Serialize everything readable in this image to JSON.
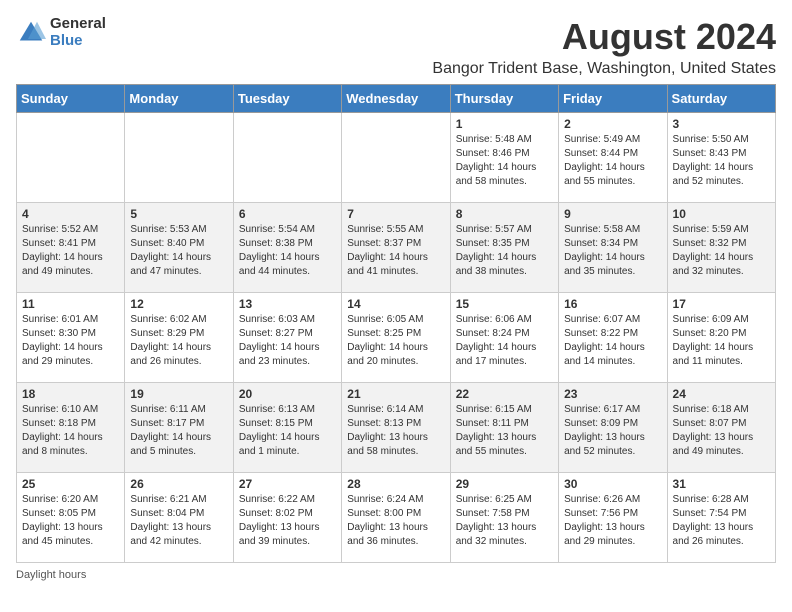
{
  "logo": {
    "general": "General",
    "blue": "Blue"
  },
  "title": "August 2024",
  "subtitle": "Bangor Trident Base, Washington, United States",
  "days_of_week": [
    "Sunday",
    "Monday",
    "Tuesday",
    "Wednesday",
    "Thursday",
    "Friday",
    "Saturday"
  ],
  "footer": "Daylight hours",
  "weeks": [
    [
      {
        "day": "",
        "info": ""
      },
      {
        "day": "",
        "info": ""
      },
      {
        "day": "",
        "info": ""
      },
      {
        "day": "",
        "info": ""
      },
      {
        "day": "1",
        "info": "Sunrise: 5:48 AM\nSunset: 8:46 PM\nDaylight: 14 hours\nand 58 minutes."
      },
      {
        "day": "2",
        "info": "Sunrise: 5:49 AM\nSunset: 8:44 PM\nDaylight: 14 hours\nand 55 minutes."
      },
      {
        "day": "3",
        "info": "Sunrise: 5:50 AM\nSunset: 8:43 PM\nDaylight: 14 hours\nand 52 minutes."
      }
    ],
    [
      {
        "day": "4",
        "info": "Sunrise: 5:52 AM\nSunset: 8:41 PM\nDaylight: 14 hours\nand 49 minutes."
      },
      {
        "day": "5",
        "info": "Sunrise: 5:53 AM\nSunset: 8:40 PM\nDaylight: 14 hours\nand 47 minutes."
      },
      {
        "day": "6",
        "info": "Sunrise: 5:54 AM\nSunset: 8:38 PM\nDaylight: 14 hours\nand 44 minutes."
      },
      {
        "day": "7",
        "info": "Sunrise: 5:55 AM\nSunset: 8:37 PM\nDaylight: 14 hours\nand 41 minutes."
      },
      {
        "day": "8",
        "info": "Sunrise: 5:57 AM\nSunset: 8:35 PM\nDaylight: 14 hours\nand 38 minutes."
      },
      {
        "day": "9",
        "info": "Sunrise: 5:58 AM\nSunset: 8:34 PM\nDaylight: 14 hours\nand 35 minutes."
      },
      {
        "day": "10",
        "info": "Sunrise: 5:59 AM\nSunset: 8:32 PM\nDaylight: 14 hours\nand 32 minutes."
      }
    ],
    [
      {
        "day": "11",
        "info": "Sunrise: 6:01 AM\nSunset: 8:30 PM\nDaylight: 14 hours\nand 29 minutes."
      },
      {
        "day": "12",
        "info": "Sunrise: 6:02 AM\nSunset: 8:29 PM\nDaylight: 14 hours\nand 26 minutes."
      },
      {
        "day": "13",
        "info": "Sunrise: 6:03 AM\nSunset: 8:27 PM\nDaylight: 14 hours\nand 23 minutes."
      },
      {
        "day": "14",
        "info": "Sunrise: 6:05 AM\nSunset: 8:25 PM\nDaylight: 14 hours\nand 20 minutes."
      },
      {
        "day": "15",
        "info": "Sunrise: 6:06 AM\nSunset: 8:24 PM\nDaylight: 14 hours\nand 17 minutes."
      },
      {
        "day": "16",
        "info": "Sunrise: 6:07 AM\nSunset: 8:22 PM\nDaylight: 14 hours\nand 14 minutes."
      },
      {
        "day": "17",
        "info": "Sunrise: 6:09 AM\nSunset: 8:20 PM\nDaylight: 14 hours\nand 11 minutes."
      }
    ],
    [
      {
        "day": "18",
        "info": "Sunrise: 6:10 AM\nSunset: 8:18 PM\nDaylight: 14 hours\nand 8 minutes."
      },
      {
        "day": "19",
        "info": "Sunrise: 6:11 AM\nSunset: 8:17 PM\nDaylight: 14 hours\nand 5 minutes."
      },
      {
        "day": "20",
        "info": "Sunrise: 6:13 AM\nSunset: 8:15 PM\nDaylight: 14 hours\nand 1 minute."
      },
      {
        "day": "21",
        "info": "Sunrise: 6:14 AM\nSunset: 8:13 PM\nDaylight: 13 hours\nand 58 minutes."
      },
      {
        "day": "22",
        "info": "Sunrise: 6:15 AM\nSunset: 8:11 PM\nDaylight: 13 hours\nand 55 minutes."
      },
      {
        "day": "23",
        "info": "Sunrise: 6:17 AM\nSunset: 8:09 PM\nDaylight: 13 hours\nand 52 minutes."
      },
      {
        "day": "24",
        "info": "Sunrise: 6:18 AM\nSunset: 8:07 PM\nDaylight: 13 hours\nand 49 minutes."
      }
    ],
    [
      {
        "day": "25",
        "info": "Sunrise: 6:20 AM\nSunset: 8:05 PM\nDaylight: 13 hours\nand 45 minutes."
      },
      {
        "day": "26",
        "info": "Sunrise: 6:21 AM\nSunset: 8:04 PM\nDaylight: 13 hours\nand 42 minutes."
      },
      {
        "day": "27",
        "info": "Sunrise: 6:22 AM\nSunset: 8:02 PM\nDaylight: 13 hours\nand 39 minutes."
      },
      {
        "day": "28",
        "info": "Sunrise: 6:24 AM\nSunset: 8:00 PM\nDaylight: 13 hours\nand 36 minutes."
      },
      {
        "day": "29",
        "info": "Sunrise: 6:25 AM\nSunset: 7:58 PM\nDaylight: 13 hours\nand 32 minutes."
      },
      {
        "day": "30",
        "info": "Sunrise: 6:26 AM\nSunset: 7:56 PM\nDaylight: 13 hours\nand 29 minutes."
      },
      {
        "day": "31",
        "info": "Sunrise: 6:28 AM\nSunset: 7:54 PM\nDaylight: 13 hours\nand 26 minutes."
      }
    ]
  ]
}
